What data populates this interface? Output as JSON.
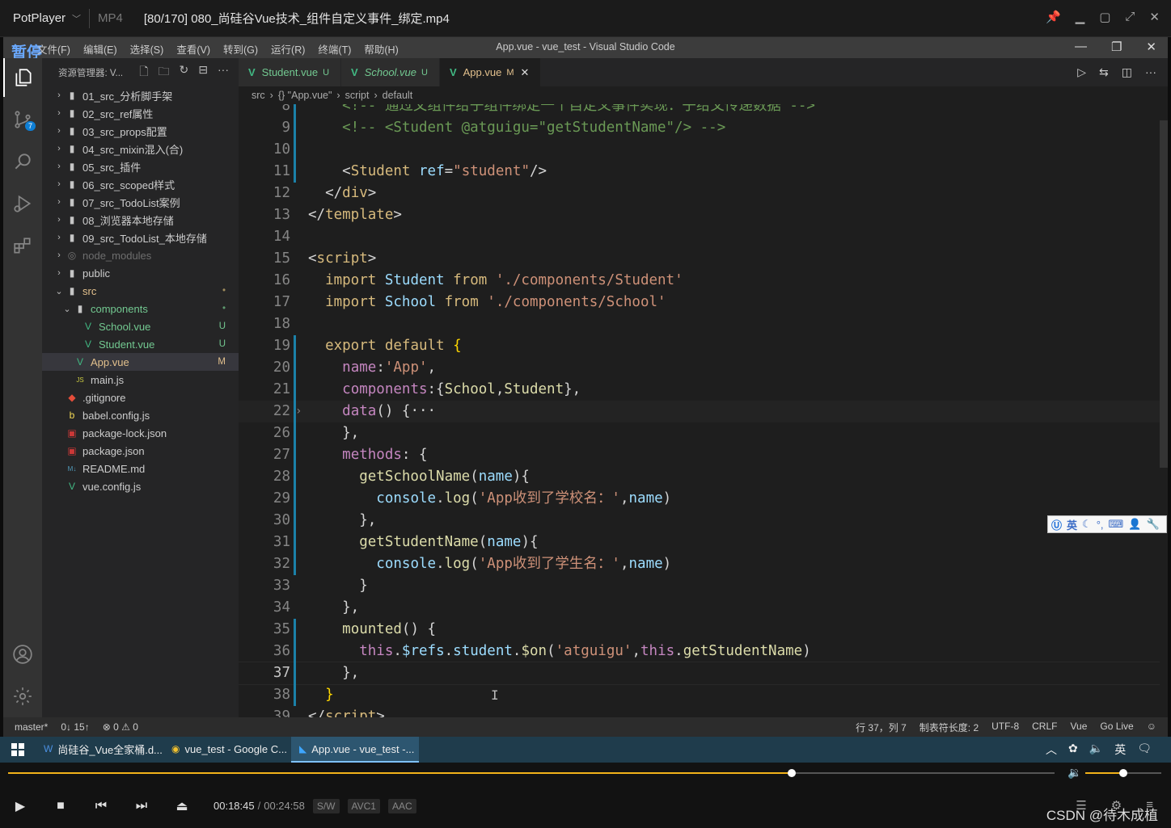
{
  "potplayer": {
    "app_name": "PotPlayer",
    "format": "MP4",
    "file_title": "[80/170] 080_尚硅谷Vue技术_组件自定义事件_绑定.mp4",
    "pause_label": "暂停",
    "time_current": "00:18:45",
    "time_separator": "/",
    "time_total": "00:24:58",
    "tags": [
      "S/W",
      "AVC1",
      "AAC"
    ],
    "progress_fraction": 0.749,
    "volume_fraction": 0.5,
    "accent_color": "#f2b21a"
  },
  "vscode": {
    "window_title": "App.vue - vue_test - Visual Studio Code",
    "menu": [
      "文件(F)",
      "编辑(E)",
      "选择(S)",
      "查看(V)",
      "转到(G)",
      "运行(R)",
      "终端(T)",
      "帮助(H)"
    ],
    "explorer_title": "资源管理器: V...",
    "scm_badge": "7",
    "tree": [
      {
        "label": "01_src_分析脚手架",
        "type": "folder",
        "depth": 0,
        "open": false
      },
      {
        "label": "02_src_ref属性",
        "type": "folder",
        "depth": 0,
        "open": false
      },
      {
        "label": "03_src_props配置",
        "type": "folder",
        "depth": 0,
        "open": false
      },
      {
        "label": "04_src_mixin混入(合)",
        "type": "folder",
        "depth": 0,
        "open": false
      },
      {
        "label": "05_src_插件",
        "type": "folder",
        "depth": 0,
        "open": false
      },
      {
        "label": "06_src_scoped样式",
        "type": "folder",
        "depth": 0,
        "open": false
      },
      {
        "label": "07_src_TodoList案例",
        "type": "folder",
        "depth": 0,
        "open": false
      },
      {
        "label": "08_浏览器本地存储",
        "type": "folder",
        "depth": 0,
        "open": false
      },
      {
        "label": "09_src_TodoList_本地存储",
        "type": "folder",
        "depth": 0,
        "open": false
      },
      {
        "label": "node_modules",
        "type": "folder-dim",
        "depth": 0,
        "open": false
      },
      {
        "label": "public",
        "type": "folder",
        "depth": 0,
        "open": false
      },
      {
        "label": "src",
        "type": "folder-mod",
        "depth": 0,
        "open": true,
        "status": "•"
      },
      {
        "label": "components",
        "type": "folder-new",
        "depth": 1,
        "open": true,
        "status": "•"
      },
      {
        "label": "School.vue",
        "type": "vue-new",
        "depth": 2,
        "status": "U"
      },
      {
        "label": "Student.vue",
        "type": "vue-new",
        "depth": 2,
        "status": "U"
      },
      {
        "label": "App.vue",
        "type": "vue-mod",
        "depth": 1,
        "status": "M",
        "selected": true
      },
      {
        "label": "main.js",
        "type": "js",
        "depth": 1
      },
      {
        "label": ".gitignore",
        "type": "git",
        "depth": 0
      },
      {
        "label": "babel.config.js",
        "type": "babel",
        "depth": 0
      },
      {
        "label": "package-lock.json",
        "type": "npm",
        "depth": 0
      },
      {
        "label": "package.json",
        "type": "npm",
        "depth": 0
      },
      {
        "label": "README.md",
        "type": "md",
        "depth": 0
      },
      {
        "label": "vue.config.js",
        "type": "vue",
        "depth": 0
      }
    ],
    "tabs": [
      {
        "label": "Student.vue",
        "status": "U",
        "color": "#73c991",
        "italic": false,
        "active": false
      },
      {
        "label": "School.vue",
        "status": "U",
        "color": "#73c991",
        "italic": true,
        "active": false
      },
      {
        "label": "App.vue",
        "status": "M",
        "color": "#e2c08d",
        "italic": false,
        "active": true
      }
    ],
    "breadcrumbs": [
      "src",
      "{} \"App.vue\"",
      "script",
      "default"
    ],
    "code": [
      {
        "n": "8",
        "tokens": [
          [
            "c",
            "    <!-- 通过父组件给子组件绑定一个自定义事件实现：子给父传递数据 -->"
          ]
        ]
      },
      {
        "n": "9",
        "tokens": [
          [
            "c",
            "    <!-- <Student @atguigu=\"getStudentName\"/> -->"
          ]
        ]
      },
      {
        "n": "10",
        "tokens": []
      },
      {
        "n": "11",
        "tokens": [
          [
            "p",
            "    <"
          ],
          [
            "tg",
            "Student"
          ],
          [
            "p",
            " "
          ],
          [
            "a",
            "ref"
          ],
          [
            "p",
            "="
          ],
          [
            "s",
            "\"student\""
          ],
          [
            "p",
            "/>"
          ]
        ]
      },
      {
        "n": "12",
        "tokens": [
          [
            "p",
            "  </"
          ],
          [
            "tg",
            "div"
          ],
          [
            "p",
            ">"
          ]
        ]
      },
      {
        "n": "13",
        "tokens": [
          [
            "p",
            "</"
          ],
          [
            "tg",
            "template"
          ],
          [
            "p",
            ">"
          ]
        ]
      },
      {
        "n": "14",
        "tokens": []
      },
      {
        "n": "15",
        "tokens": [
          [
            "p",
            "<"
          ],
          [
            "tg",
            "script"
          ],
          [
            "p",
            ">"
          ]
        ]
      },
      {
        "n": "16",
        "tokens": [
          [
            "p",
            "  "
          ],
          [
            "kw",
            "import"
          ],
          [
            "v",
            " Student "
          ],
          [
            "kw",
            "from"
          ],
          [
            "p",
            " "
          ],
          [
            "s",
            "'./components/Student'"
          ]
        ]
      },
      {
        "n": "17",
        "tokens": [
          [
            "p",
            "  "
          ],
          [
            "kw",
            "import"
          ],
          [
            "v",
            " School "
          ],
          [
            "kw",
            "from"
          ],
          [
            "p",
            " "
          ],
          [
            "s",
            "'./components/School'"
          ]
        ]
      },
      {
        "n": "18",
        "tokens": []
      },
      {
        "n": "19",
        "tokens": [
          [
            "p",
            "  "
          ],
          [
            "kw",
            "export"
          ],
          [
            "p",
            " "
          ],
          [
            "kw",
            "default"
          ],
          [
            "p",
            " "
          ],
          [
            "y",
            "{"
          ]
        ]
      },
      {
        "n": "20",
        "tokens": [
          [
            "p",
            "    "
          ],
          [
            "k",
            "name"
          ],
          [
            "p",
            ":"
          ],
          [
            "s",
            "'App'"
          ],
          [
            "p",
            ","
          ]
        ]
      },
      {
        "n": "21",
        "tokens": [
          [
            "p",
            "    "
          ],
          [
            "k",
            "components"
          ],
          [
            "p",
            ":{"
          ],
          [
            "f",
            "School"
          ],
          [
            "p",
            ","
          ],
          [
            "f",
            "Student"
          ],
          [
            "p",
            "},"
          ]
        ]
      },
      {
        "n": "22",
        "tokens": [
          [
            "p",
            "    "
          ],
          [
            "k",
            "data"
          ],
          [
            "p",
            "() {"
          ],
          [
            "p",
            "···"
          ]
        ],
        "fold": true
      },
      {
        "n": "26",
        "tokens": [
          [
            "p",
            "    },"
          ]
        ]
      },
      {
        "n": "27",
        "tokens": [
          [
            "p",
            "    "
          ],
          [
            "k",
            "methods"
          ],
          [
            "p",
            ": {"
          ]
        ]
      },
      {
        "n": "28",
        "tokens": [
          [
            "p",
            "      "
          ],
          [
            "f",
            "getSchoolName"
          ],
          [
            "p",
            "("
          ],
          [
            "a",
            "name"
          ],
          [
            "p",
            "){"
          ]
        ]
      },
      {
        "n": "29",
        "tokens": [
          [
            "p",
            "        "
          ],
          [
            "v",
            "console"
          ],
          [
            "p",
            "."
          ],
          [
            "f",
            "log"
          ],
          [
            "p",
            "("
          ],
          [
            "s",
            "'App收到了学校名：'"
          ],
          [
            "p",
            ","
          ],
          [
            "a",
            "name"
          ],
          [
            "p",
            ")"
          ]
        ]
      },
      {
        "n": "30",
        "tokens": [
          [
            "p",
            "      },"
          ]
        ]
      },
      {
        "n": "31",
        "tokens": [
          [
            "p",
            "      "
          ],
          [
            "f",
            "getStudentName"
          ],
          [
            "p",
            "("
          ],
          [
            "a",
            "name"
          ],
          [
            "p",
            "){"
          ]
        ]
      },
      {
        "n": "32",
        "tokens": [
          [
            "p",
            "        "
          ],
          [
            "v",
            "console"
          ],
          [
            "p",
            "."
          ],
          [
            "f",
            "log"
          ],
          [
            "p",
            "("
          ],
          [
            "s",
            "'App收到了学生名：'"
          ],
          [
            "p",
            ","
          ],
          [
            "a",
            "name"
          ],
          [
            "p",
            ")"
          ]
        ]
      },
      {
        "n": "33",
        "tokens": [
          [
            "p",
            "      }"
          ]
        ]
      },
      {
        "n": "34",
        "tokens": [
          [
            "p",
            "    },"
          ]
        ]
      },
      {
        "n": "35",
        "tokens": [
          [
            "p",
            "    "
          ],
          [
            "f",
            "mounted"
          ],
          [
            "p",
            "() {"
          ]
        ]
      },
      {
        "n": "36",
        "tokens": [
          [
            "p",
            "      "
          ],
          [
            "k",
            "this"
          ],
          [
            "p",
            "."
          ],
          [
            "v",
            "$refs"
          ],
          [
            "p",
            "."
          ],
          [
            "v",
            "student"
          ],
          [
            "p",
            "."
          ],
          [
            "f",
            "$on"
          ],
          [
            "p",
            "("
          ],
          [
            "s",
            "'atguigu'"
          ],
          [
            "p",
            ","
          ],
          [
            "k",
            "this"
          ],
          [
            "p",
            "."
          ],
          [
            "f",
            "getStudentName"
          ],
          [
            "p",
            ")"
          ]
        ]
      },
      {
        "n": "37",
        "tokens": [
          [
            "p",
            "    },"
          ]
        ],
        "current": true
      },
      {
        "n": "38",
        "tokens": [
          [
            "p",
            "  "
          ],
          [
            "y",
            "}"
          ]
        ]
      },
      {
        "n": "39",
        "tokens": [
          [
            "p",
            "</"
          ],
          [
            "tg",
            "script"
          ],
          [
            "p",
            ">"
          ]
        ]
      }
    ],
    "status_left": [
      "master*",
      "0↓ 15↑",
      "⊗ 0 ⚠ 0"
    ],
    "status_right": [
      "行 37，列 7",
      "制表符长度: 2",
      "UTF-8",
      "CRLF",
      "Vue",
      "Go Live"
    ],
    "ime_label": "英"
  },
  "taskbar": {
    "items": [
      {
        "label": "尚硅谷_Vue全家桶.d...",
        "icon": "word-icon",
        "active": false
      },
      {
        "label": "vue_test - Google C...",
        "icon": "chrome-icon",
        "active": false
      },
      {
        "label": "App.vue - vue_test -...",
        "icon": "vscode-icon",
        "active": true
      }
    ],
    "tray_lang": "英"
  },
  "watermark": "CSDN @待木成植"
}
